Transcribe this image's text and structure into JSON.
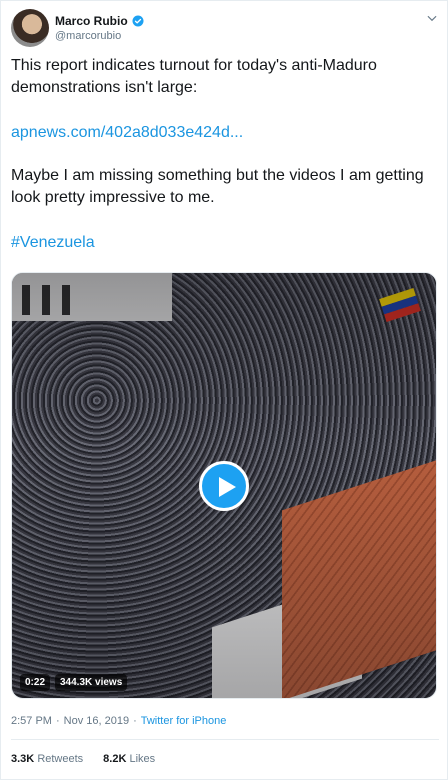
{
  "author": {
    "name": "Marco Rubio",
    "handle": "@marcorubio"
  },
  "tweet": {
    "text_1": "This report indicates turnout for today's anti-Maduro demonstrations isn't large:",
    "link": "apnews.com/402a8d033e424d...",
    "text_2": "Maybe I am missing something but the videos I am getting look pretty impressive to me.",
    "hashtag": "#Venezuela"
  },
  "media": {
    "duration": "0:22",
    "views": "344.3K views"
  },
  "meta": {
    "time": "2:57 PM",
    "separator_1": "·",
    "date": "Nov 16, 2019",
    "separator_2": "·",
    "source": "Twitter for iPhone"
  },
  "stats": {
    "retweets_count": "3.3K",
    "retweets_label": "Retweets",
    "likes_count": "8.2K",
    "likes_label": "Likes"
  },
  "colors": {
    "link": "#1b95e0",
    "play": "#1da1f2",
    "muted": "#657786"
  }
}
